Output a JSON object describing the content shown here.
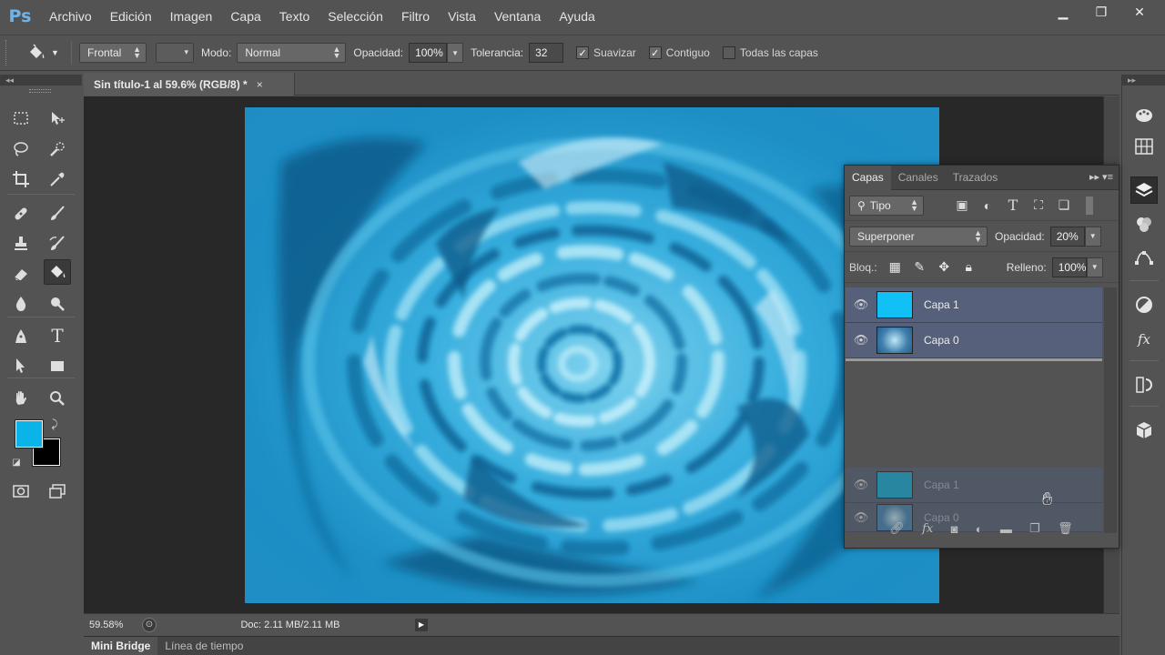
{
  "app": {
    "logo": "Ps"
  },
  "menu": [
    "Archivo",
    "Edición",
    "Imagen",
    "Capa",
    "Texto",
    "Selección",
    "Filtro",
    "Vista",
    "Ventana",
    "Ayuda"
  ],
  "window_controls": {
    "minimize": "▁",
    "restore": "❐",
    "close": "✕"
  },
  "options": {
    "tool_icon": "paint-bucket-icon",
    "fill_source": "Frontal",
    "mode_label": "Modo:",
    "mode_value": "Normal",
    "opacity_label": "Opacidad:",
    "opacity_value": "100%",
    "tolerance_label": "Tolerancia:",
    "tolerance_value": "32",
    "antialias_label": "Suavizar",
    "antialias_checked": true,
    "contiguous_label": "Contiguo",
    "contiguous_checked": true,
    "all_layers_label": "Todas las capas",
    "all_layers_checked": false
  },
  "document": {
    "tab_title": "Sin título-1 al 59.6% (RGB/8) *",
    "close": "×",
    "zoom": "59.58%",
    "doc_info": "Doc: 2.11 MB/2.11 MB"
  },
  "colors": {
    "foreground": "#0ab4e9",
    "background": "#000000",
    "layer_fill": "#11c0f5"
  },
  "bottom_tabs": [
    "Mini Bridge",
    "Línea de tiempo"
  ],
  "layers_panel": {
    "tabs": [
      "Capas",
      "Canales",
      "Trazados"
    ],
    "filter_kind": "Tipo",
    "blend_mode": "Superponer",
    "opacity_label": "Opacidad:",
    "opacity_value": "20%",
    "lock_label": "Bloq.:",
    "fill_label": "Relleno:",
    "fill_value": "100%",
    "layers": [
      {
        "name": "Capa 1",
        "visible": true
      },
      {
        "name": "Capa 0",
        "visible": true
      }
    ],
    "dragging": [
      {
        "name": "Capa 1"
      },
      {
        "name": "Capa 0"
      }
    ]
  }
}
